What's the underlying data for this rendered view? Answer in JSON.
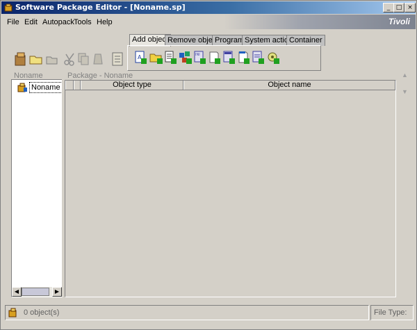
{
  "window": {
    "title": "Software Package Editor - [Noname.sp]",
    "minimize": "_",
    "maximize": "□",
    "close": "×"
  },
  "menubar": {
    "items": [
      "File",
      "Edit",
      "Autopack",
      "Tools",
      "Help"
    ],
    "brand": "Tivoli"
  },
  "tabs": [
    {
      "label": "Add object",
      "active": true
    },
    {
      "label": "Remove object",
      "active": false
    },
    {
      "label": "Program",
      "active": false
    },
    {
      "label": "System action",
      "active": false
    },
    {
      "label": "Container",
      "active": false
    }
  ],
  "tree": {
    "header": "Noname",
    "item": "Noname"
  },
  "package": {
    "header": "Package - Noname",
    "columns": [
      "Object type",
      "Object name"
    ]
  },
  "status": {
    "objects": "0 object(s)",
    "file_type": "File Type:"
  },
  "colors": {
    "title_start": "#0a246a",
    "title_end": "#a6caf0",
    "face": "#d4d0c8"
  }
}
